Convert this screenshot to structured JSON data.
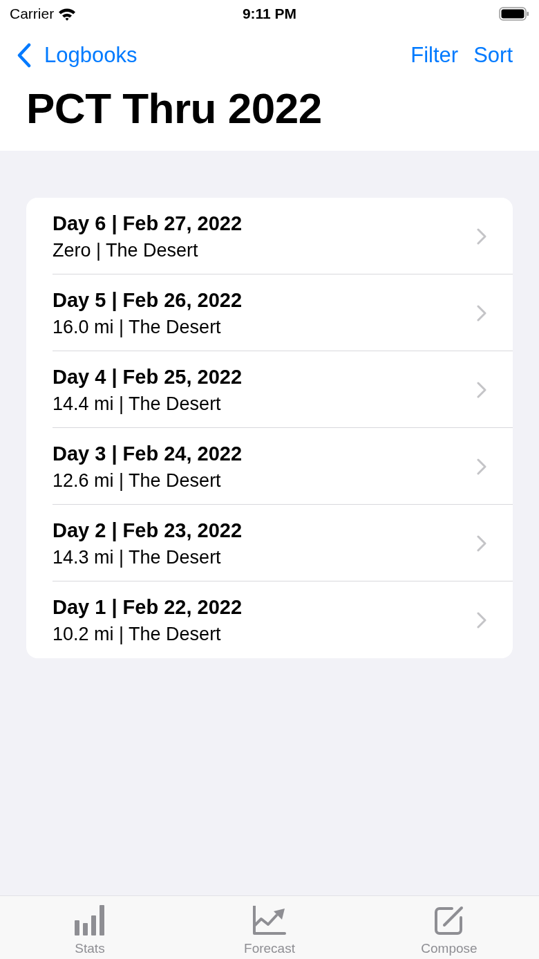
{
  "status_bar": {
    "carrier": "Carrier",
    "time": "9:11 PM"
  },
  "nav_bar": {
    "back_label": "Logbooks",
    "actions": [
      "Filter",
      "Sort"
    ],
    "title": "PCT Thru 2022"
  },
  "entries": [
    {
      "title": "Day 6 | Feb 27, 2022",
      "subtitle": "Zero | The Desert"
    },
    {
      "title": "Day 5 | Feb 26, 2022",
      "subtitle": "16.0 mi | The Desert"
    },
    {
      "title": "Day 4 | Feb 25, 2022",
      "subtitle": "14.4 mi | The Desert"
    },
    {
      "title": "Day 3 | Feb 24, 2022",
      "subtitle": "12.6 mi | The Desert"
    },
    {
      "title": "Day 2 | Feb 23, 2022",
      "subtitle": "14.3 mi | The Desert"
    },
    {
      "title": "Day 1 | Feb 22, 2022",
      "subtitle": "10.2 mi | The Desert"
    }
  ],
  "toolbar": [
    {
      "kind": "stats",
      "label": "Stats"
    },
    {
      "kind": "forecast",
      "label": "Forecast"
    },
    {
      "kind": "compose",
      "label": "Compose"
    }
  ]
}
